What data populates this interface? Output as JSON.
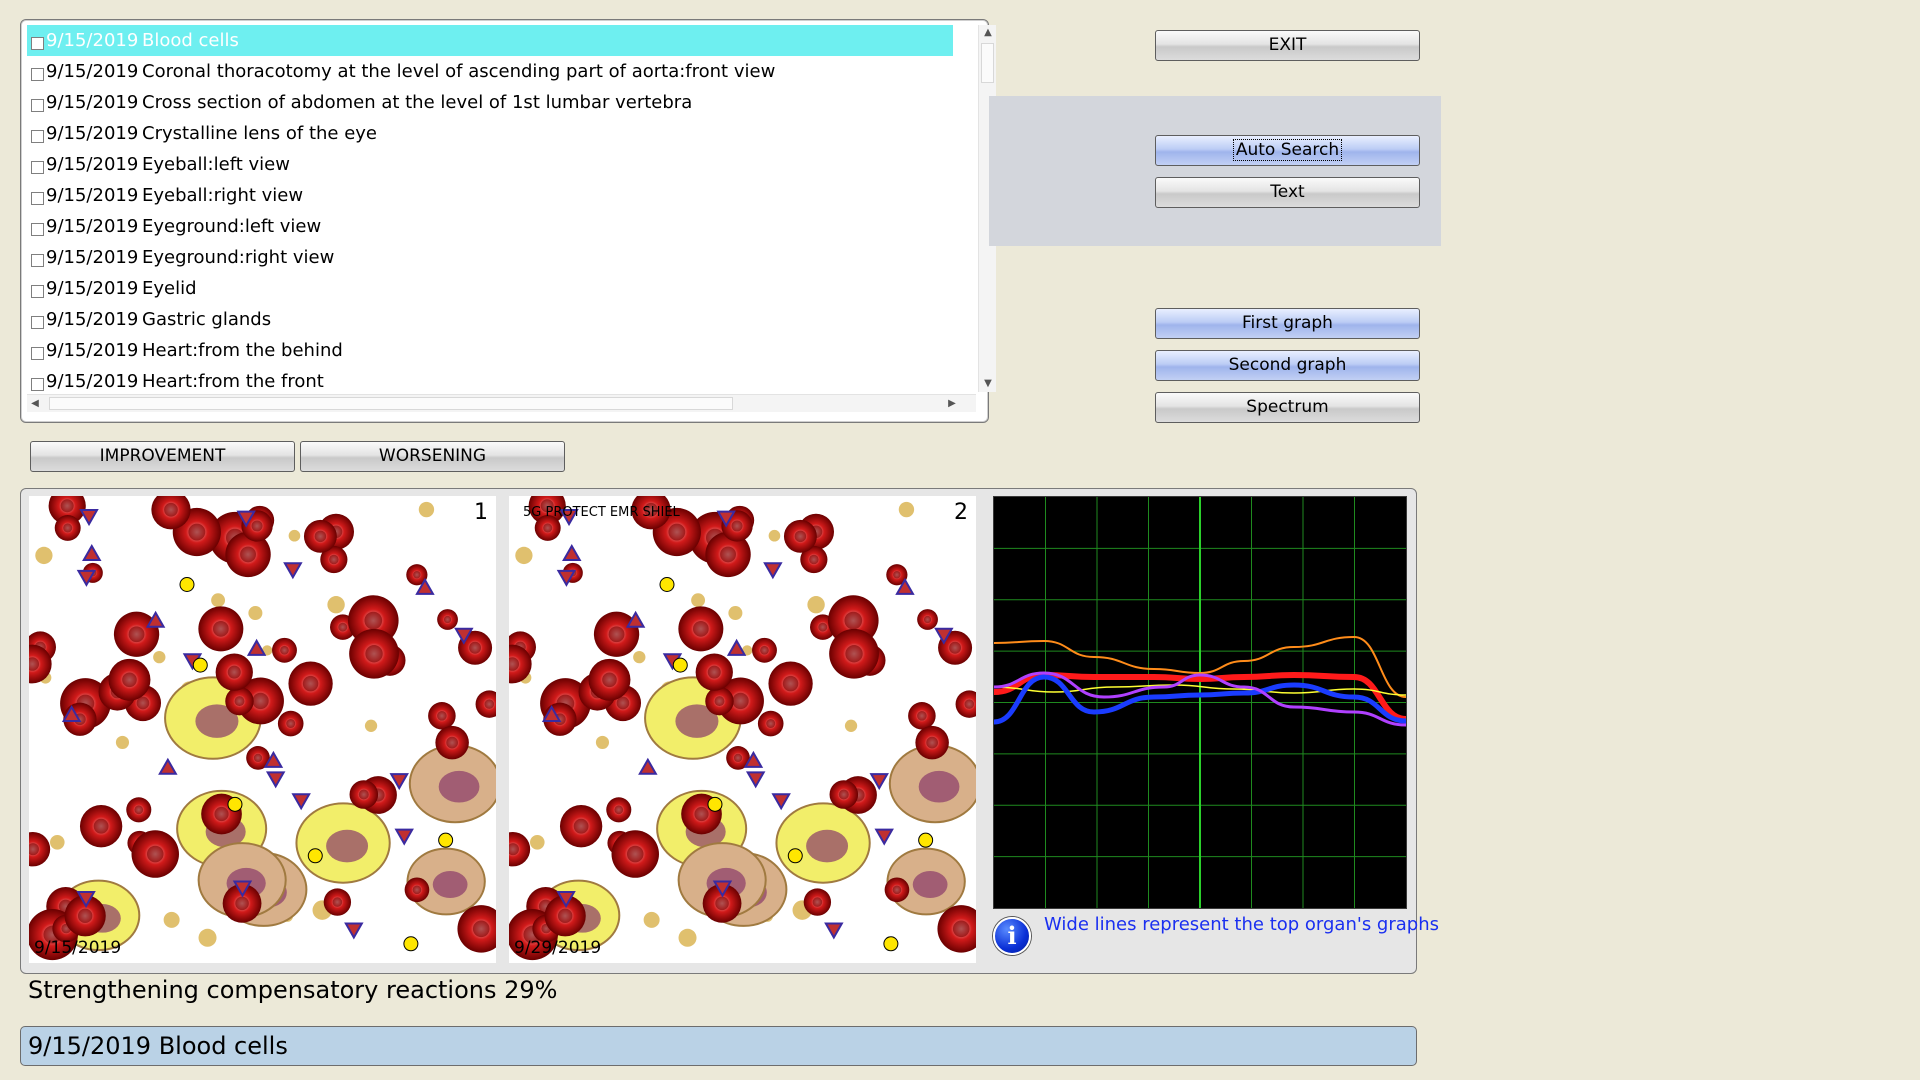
{
  "organ_list": {
    "items": [
      {
        "date": "9/15/2019",
        "name": "Blood cells",
        "selected": true
      },
      {
        "date": "9/15/2019",
        "name": "Coronal thoracotomy at the level of ascending part of aorta:front view"
      },
      {
        "date": "9/15/2019",
        "name": "Cross section of abdomen at the level of 1st lumbar vertebra"
      },
      {
        "date": "9/15/2019",
        "name": "Crystalline lens of the eye"
      },
      {
        "date": "9/15/2019",
        "name": "Eyeball:left view"
      },
      {
        "date": "9/15/2019",
        "name": "Eyeball:right view"
      },
      {
        "date": "9/15/2019",
        "name": "Eyeground:left view"
      },
      {
        "date": "9/15/2019",
        "name": "Eyeground:right view"
      },
      {
        "date": "9/15/2019",
        "name": "Eyelid"
      },
      {
        "date": "9/15/2019",
        "name": "Gastric glands"
      },
      {
        "date": "9/15/2019",
        "name": "Heart:from the behind"
      },
      {
        "date": "9/15/2019",
        "name": "Heart:from the front"
      }
    ],
    "selected_color": "#6EEFF0"
  },
  "buttons": {
    "exit": "EXIT",
    "auto_search": "Auto Search",
    "text": "Text",
    "first_graph": "First graph",
    "second_graph": "Second graph",
    "spectrum": "Spectrum",
    "improvement": "IMPROVEMENT",
    "worsening": "WORSENING"
  },
  "panels": {
    "left": {
      "number": "1",
      "date": "9/15/2019"
    },
    "right": {
      "number": "2",
      "date": "9/29/2019",
      "tag": "5G PROTECT EMR SHIEL"
    }
  },
  "graph": {
    "grid_color": "#1f8a1f",
    "info_text": "Wide lines represent the top organ's graphs",
    "series_colors": [
      "#ff8c1a",
      "#ff1a1a",
      "#ffff33",
      "#1a3cff",
      "#b040ff"
    ]
  },
  "result_text": "Strengthening compensatory reactions 29%",
  "status_bar": "9/15/2019 Blood cells",
  "icons": {
    "info": "info-icon",
    "panel_markers": [
      "triangle-marker",
      "diamond-marker",
      "hexagon-marker"
    ]
  }
}
